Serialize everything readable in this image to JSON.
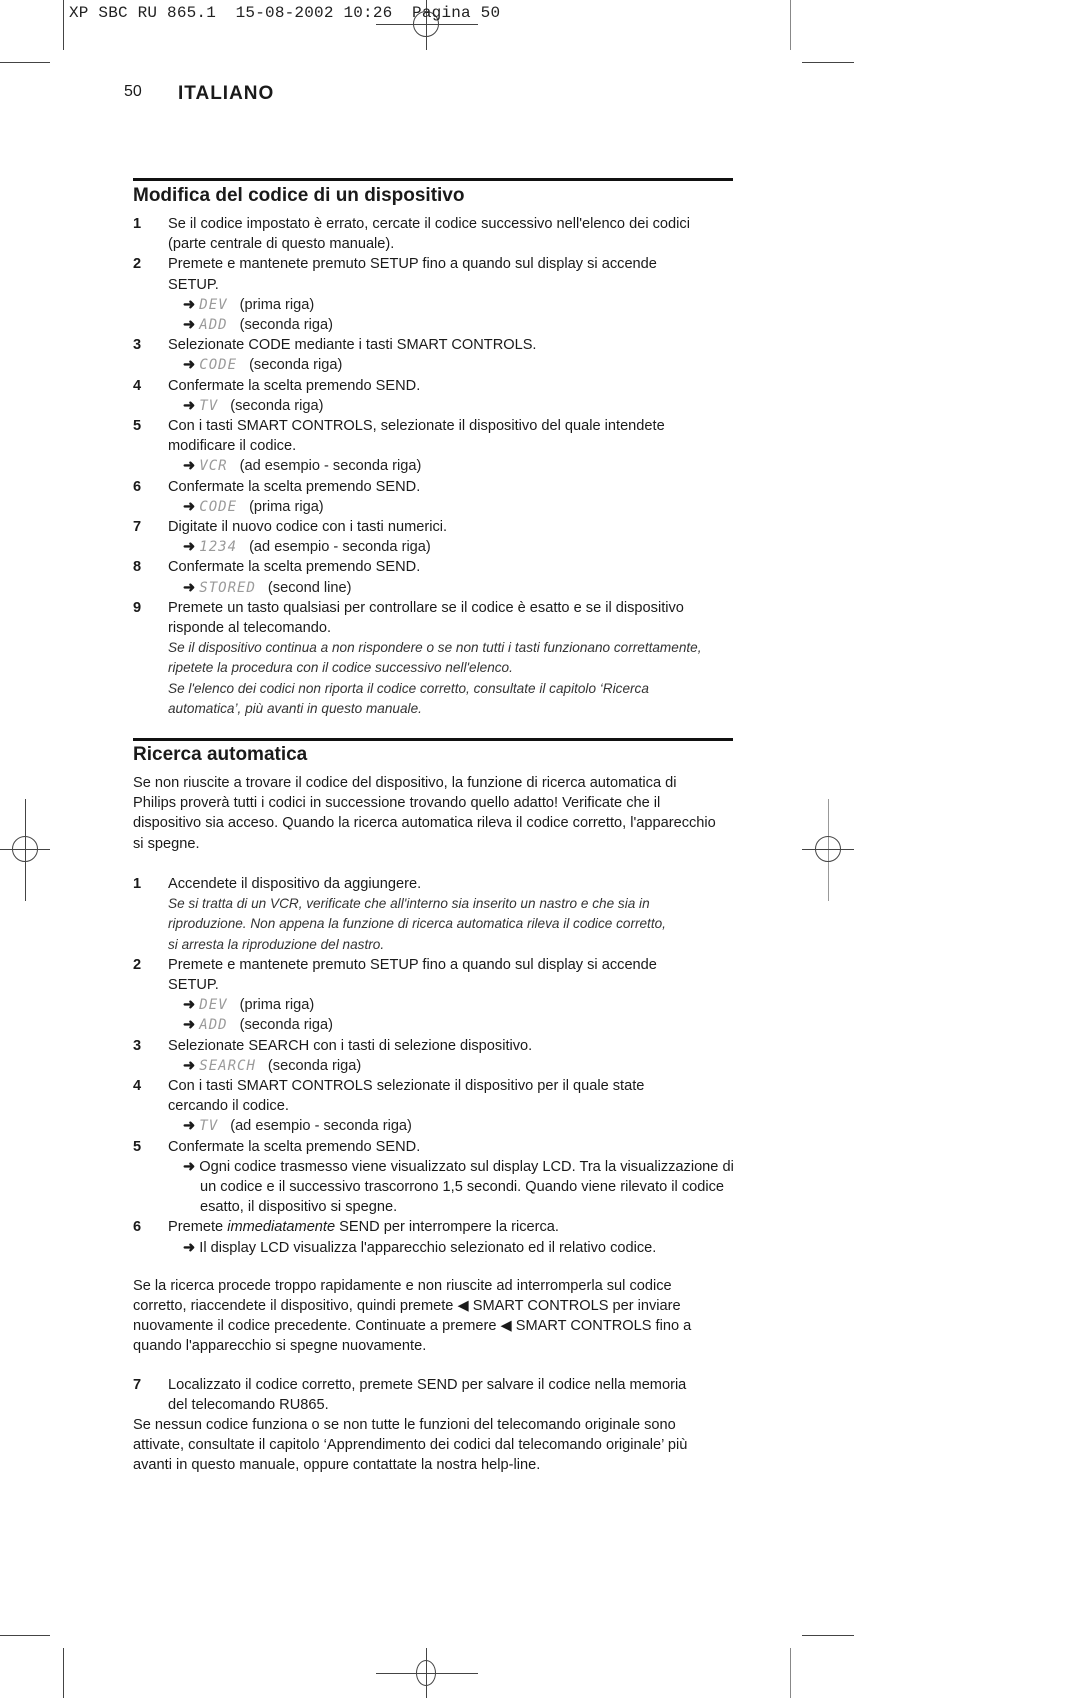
{
  "slug": "XP SBC RU 865.1  15-08-2002 10:26  Pagina 50",
  "page_number": "50",
  "language": "ITALIANO",
  "section1": {
    "title": "Modifica del codice di un dispositivo",
    "steps": [
      {
        "num": "1",
        "lines": [
          "Se il codice impostato è errato, cercate il codice successivo nell'elenco dei codici",
          "(parte centrale di questo manuale)."
        ]
      },
      {
        "num": "2",
        "lines": [
          "Premete e mantenete premuto SETUP fino a quando sul display si accende",
          "SETUP."
        ],
        "results": [
          {
            "lcd": "DEV",
            "note": "(prima riga)"
          },
          {
            "lcd": "ADD",
            "note": "(seconda riga)"
          }
        ]
      },
      {
        "num": "3",
        "lines": [
          "Selezionate CODE mediante i tasti SMART CONTROLS."
        ],
        "results": [
          {
            "lcd": "CODE",
            "note": "(seconda riga)"
          }
        ]
      },
      {
        "num": "4",
        "lines": [
          "Confermate la scelta premendo SEND."
        ],
        "results": [
          {
            "lcd": "TV",
            "note": "(seconda riga)"
          }
        ]
      },
      {
        "num": "5",
        "lines": [
          "Con i tasti SMART CONTROLS, selezionate il dispositivo del quale intendete",
          "modificare il codice."
        ],
        "results": [
          {
            "lcd": "VCR",
            "note": "(ad esempio - seconda riga)"
          }
        ]
      },
      {
        "num": "6",
        "lines": [
          "Confermate la scelta premendo SEND."
        ],
        "results": [
          {
            "lcd": "CODE",
            "note": "(prima riga)"
          }
        ]
      },
      {
        "num": "7",
        "lines": [
          "Digitate il nuovo codice con i tasti numerici."
        ],
        "results": [
          {
            "lcd": "1234",
            "note": "(ad esempio - seconda riga)"
          }
        ]
      },
      {
        "num": "8",
        "lines": [
          "Confermate la scelta premendo SEND."
        ],
        "results": [
          {
            "lcd": "STORED",
            "note": "(second line)"
          }
        ]
      },
      {
        "num": "9",
        "lines": [
          "Premete un tasto qualsiasi per controllare se il codice è esatto e se il dispositivo",
          "risponde al telecomando."
        ],
        "notes": [
          "Se il dispositivo continua a non rispondere o se non tutti i tasti funzionano correttamente,",
          "ripetete la procedura con il codice successivo nell'elenco.",
          "Se l'elenco dei codici non riporta il codice corretto, consultate il capitolo ‘Ricerca",
          "automatica’, più avanti in questo manuale."
        ]
      }
    ]
  },
  "section2": {
    "title": "Ricerca automatica",
    "intro": [
      "Se non riuscite a trovare il codice del dispositivo, la funzione di ricerca automatica di",
      "Philips proverà tutti i codici in successione trovando quello adatto! Verificate che il",
      "dispositivo sia acceso. Quando la ricerca automatica rileva il codice corretto, l'apparecchio",
      "si spegne."
    ],
    "steps": [
      {
        "num": "1",
        "lines": [
          "Accendete il dispositivo da aggiungere."
        ],
        "notes": [
          "Se si tratta di un VCR, verificate che all'interno sia inserito un nastro e che sia in",
          "riproduzione. Non appena la funzione di ricerca automatica rileva il codice corretto,",
          "si arresta la riproduzione del nastro."
        ]
      },
      {
        "num": "2",
        "lines": [
          "Premete e mantenete premuto SETUP fino a quando sul display si accende",
          "SETUP."
        ],
        "results": [
          {
            "lcd": "DEV",
            "note": "(prima riga)"
          },
          {
            "lcd": "ADD",
            "note": "(seconda riga)"
          }
        ]
      },
      {
        "num": "3",
        "lines": [
          "Selezionate SEARCH con i tasti di selezione dispositivo."
        ],
        "results": [
          {
            "lcd": "SEARCH",
            "note": "(seconda riga)"
          }
        ]
      },
      {
        "num": "4",
        "lines": [
          "Con i tasti SMART CONTROLS selezionate il dispositivo per il quale state",
          "cercando il codice."
        ],
        "results": [
          {
            "lcd": "TV",
            "note": "(ad esempio - seconda riga)"
          }
        ]
      },
      {
        "num": "5",
        "lines": [
          "Confermate la scelta premendo SEND."
        ],
        "result_text": [
          "Ogni codice trasmesso viene visualizzato sul display LCD.  Tra la visualizzazione di",
          "un codice e il successivo trascorrono 1,5 secondi. Quando viene rilevato il codice",
          "esatto, il dispositivo si spegne."
        ]
      },
      {
        "num": "6",
        "pre": "Premete ",
        "em": "immediatamente",
        "post": " SEND per interrompere la ricerca.",
        "result_text": [
          "Il display LCD visualizza l'apparecchio selezionato ed il relativo codice."
        ]
      }
    ],
    "para": [
      "Se la ricerca procede troppo rapidamente e non riuscite ad interromperla sul codice",
      "corretto, riaccendete il dispositivo, quindi premete ◀ SMART CONTROLS per inviare",
      "nuovamente il codice precedente. Continuate a premere ◀ SMART CONTROLS fino a",
      "quando l'apparecchio si spegne nuovamente."
    ],
    "step7": {
      "num": "7",
      "lines": [
        "Localizzato il codice corretto, premete SEND per salvare il codice nella memoria",
        "del telecomando RU865."
      ]
    },
    "closing": [
      "Se nessun codice funziona o se non tutte le funzioni del telecomando originale sono",
      "attivate, consultate il capitolo ‘Apprendimento dei codici dal telecomando originale’ più",
      "avanti in questo manuale, oppure contattate la nostra help-line."
    ]
  },
  "arrow_glyph": "➜"
}
